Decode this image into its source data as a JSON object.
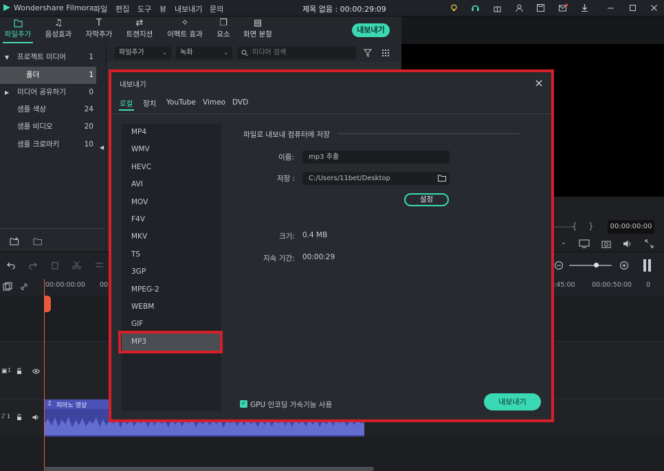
{
  "app": {
    "title": "Wondershare Filmora",
    "doc_title": "제목 없음 : 00:00:29:09"
  },
  "menu": [
    "파일",
    "편집",
    "도구",
    "뷰",
    "내보내기",
    "문의"
  ],
  "toolbar": {
    "tabs": [
      {
        "label": "파일추가",
        "icon": "folder-icon",
        "active": true
      },
      {
        "label": "음성효과",
        "icon": "music-note-icon",
        "active": false
      },
      {
        "label": "자막추가",
        "icon": "text-icon",
        "active": false
      },
      {
        "label": "트랜지션",
        "icon": "transition-icon",
        "active": false
      },
      {
        "label": "이펙트 효과",
        "icon": "effects-icon",
        "active": false
      },
      {
        "label": "요소",
        "icon": "elements-icon",
        "active": false
      },
      {
        "label": "화면 분할",
        "icon": "split-screen-icon",
        "active": false
      }
    ],
    "export_label": "내보내기"
  },
  "sidebar": {
    "items": [
      {
        "label": "프로젝트 미디어",
        "count": "1"
      },
      {
        "label": "폴더",
        "count": "1"
      },
      {
        "label": "미디어 공유하기",
        "count": "0"
      },
      {
        "label": "샘플 색상",
        "count": "24"
      },
      {
        "label": "샘플 비디오",
        "count": "20"
      },
      {
        "label": "샘플 크로마키",
        "count": "10"
      }
    ]
  },
  "filter": {
    "dropdown1": "파일추가",
    "dropdown2": "녹화",
    "search_placeholder": "미디어 검색"
  },
  "preview": {
    "timecode": "00:00:00:00",
    "brace_open": "{",
    "brace_close": "}"
  },
  "timeline": {
    "ruler": [
      "00:00:00:00",
      "00",
      ":45:00",
      "00:00:50:00"
    ],
    "audio_clip": "피아노 영상",
    "track_video": "1",
    "track_audio": "1"
  },
  "dialog": {
    "title": "내보내기",
    "tabs": [
      "로컬",
      "장치",
      "YouTube",
      "Vimeo",
      "DVD"
    ],
    "formats": [
      "MP4",
      "WMV",
      "HEVC",
      "AVI",
      "MOV",
      "F4V",
      "MKV",
      "TS",
      "3GP",
      "MPEG-2",
      "WEBM",
      "GIF",
      "MP3"
    ],
    "section": "파일로 내보내 컴퓨터에 저장",
    "name_label": "이름:",
    "name_value": "mp3 추출",
    "save_label": "저장 :",
    "save_path": "C:/Users/11bet/Desktop",
    "settings_label": "설정",
    "size_label": "크기:",
    "size_value": "0.4 MB",
    "duration_label": "지속 기간:",
    "duration_value": "00:00:29",
    "gpu_label": "GPU 인코딩 가속기능 사용",
    "export_label": "내보내기"
  },
  "colors": {
    "accent": "#3bd8b4",
    "highlight": "#d61f26",
    "audio_wave": "#5a63c7"
  }
}
